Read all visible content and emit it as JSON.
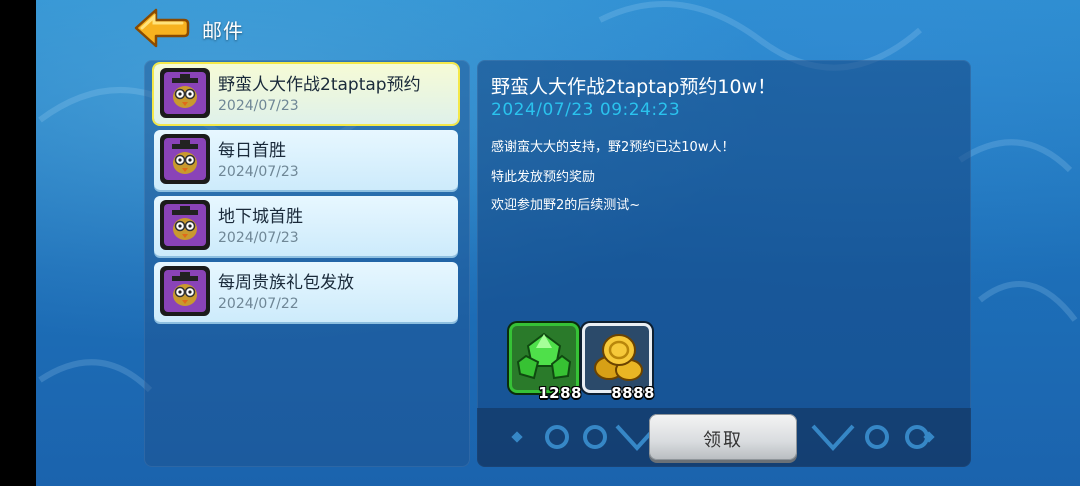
{
  "header": {
    "title": "邮件",
    "back_icon": "back-arrow-icon"
  },
  "mail_list": [
    {
      "title": "野蛮人大作战2taptap预约",
      "date": "2024/07/23",
      "selected": true
    },
    {
      "title": "每日首胜",
      "date": "2024/07/23",
      "selected": false
    },
    {
      "title": "地下城首胜",
      "date": "2024/07/23",
      "selected": false
    },
    {
      "title": "每周贵族礼包发放",
      "date": "2024/07/22",
      "selected": false
    }
  ],
  "detail": {
    "title": "野蛮人大作战2taptap预约10w！",
    "time": "2024/07/23  09:24:23",
    "body": [
      "感谢蛮大大的支持，野2预约已达10w人！",
      "特此发放预约奖励",
      "欢迎参加野2的后续测试~"
    ],
    "rewards": [
      {
        "icon": "green-gem-icon",
        "count": "1288"
      },
      {
        "icon": "gold-coin-icon",
        "count": "8888"
      }
    ],
    "claim_label": "领取"
  },
  "colors": {
    "accent_time": "#2ac3ee",
    "selected_border": "#f4e84a"
  }
}
